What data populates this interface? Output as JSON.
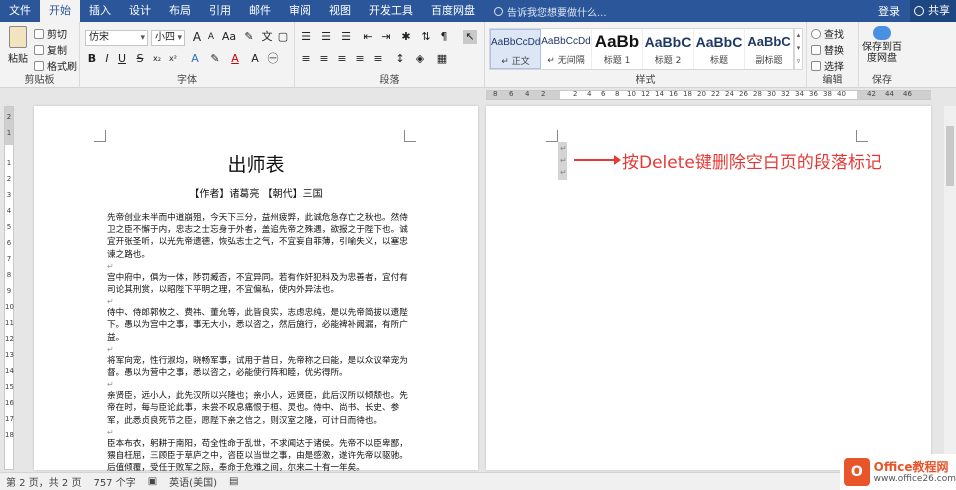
{
  "tabs": [
    "文件",
    "开始",
    "插入",
    "设计",
    "布局",
    "引用",
    "邮件",
    "审阅",
    "视图",
    "开发工具",
    "百度网盘"
  ],
  "active_tab": "开始",
  "tell_me": "告诉我您想要做什么...",
  "login": "登录",
  "share": "共享",
  "clipboard": {
    "paste": "粘贴",
    "cut": "剪切",
    "copy": "复制",
    "format_painter": "格式刷",
    "label": "剪贴板"
  },
  "font": {
    "name": "仿宋",
    "size": "小四",
    "grow": "A",
    "shrink": "A",
    "case": "Aa",
    "label": "字体"
  },
  "paragraph": {
    "label": "段落"
  },
  "styles": {
    "label": "样式",
    "items": [
      {
        "sample": "AaBbCcDd",
        "name": "↵ 正文"
      },
      {
        "sample": "AaBbCcDd",
        "name": "↵ 无间隔"
      },
      {
        "sample": "AaBb",
        "name": "标题 1"
      },
      {
        "sample": "AaBbC",
        "name": "标题 2"
      },
      {
        "sample": "AaBbC",
        "name": "标题"
      },
      {
        "sample": "AaBbC",
        "name": "副标题"
      }
    ]
  },
  "editing": {
    "find": "查找",
    "replace": "替换",
    "select": "选择",
    "label": "编辑"
  },
  "save": {
    "btn": "保存到百度网盘",
    "label": "保存"
  },
  "ruler": [
    "8",
    "6",
    "4",
    "2",
    "2",
    "4",
    "6",
    "8",
    "10",
    "12",
    "14",
    "16",
    "18",
    "20",
    "22",
    "24",
    "26",
    "28",
    "30",
    "32",
    "34",
    "36",
    "38",
    "40",
    "42",
    "44",
    "46"
  ],
  "vruler": [
    "2",
    "1",
    "1",
    "2",
    "3",
    "4",
    "5",
    "6",
    "7",
    "8",
    "9",
    "10",
    "11",
    "12",
    "13",
    "14",
    "15",
    "16",
    "17",
    "18"
  ],
  "doc": {
    "title": "出师表",
    "author": "【作者】诸葛亮 【朝代】三国",
    "paragraphs": [
      "先帝创业未半而中道崩殂，今天下三分，益州疲弊，此诚危急存亡之秋也。然侍卫之臣不懈于内，忠志之士忘身于外者，盖追先帝之殊遇，欲报之于陛下也。诚宜开张圣听，以光先帝遗德，恢弘志士之气，不宜妄自菲薄，引喻失义，以塞忠谏之路也。",
      "宫中府中，俱为一体，陟罚臧否，不宜异同。若有作奸犯科及为忠善者，宜付有司论其刑赏，以昭陛下平明之理，不宜偏私，使内外异法也。",
      "侍中、侍郎郭攸之、费祎、董允等，此皆良实，志虑忠纯，是以先帝简拔以遗陛下。愚以为宫中之事，事无大小，悉以咨之，然后施行，必能裨补阙漏，有所广益。",
      "将军向宠，性行淑均，晓畅军事，试用于昔日，先帝称之曰能，是以众议举宠为督。愚以为营中之事，悉以咨之，必能使行阵和睦，优劣得所。",
      "亲贤臣，远小人，此先汉所以兴隆也；亲小人，远贤臣，此后汉所以倾颓也。先帝在时，每与臣论此事，未尝不叹息痛恨于桓、灵也。侍中、尚书、长史、参军，此悉贞良死节之臣，愿陛下亲之信之，则汉室之隆，可计日而待也。",
      "臣本布衣，躬耕于南阳，苟全性命于乱世，不求闻达于诸侯。先帝不以臣卑鄙，猥自枉屈，三顾臣于草庐之中，咨臣以当世之事，由是感激，遂许先帝以驱驰。后值倾覆，受任于败军之际，奉命于危难之间，尔来二十有一年矣。"
    ]
  },
  "annotation": "按Delete键删除空白页的段落标记",
  "status": {
    "page": "第 2 页，共 2 页",
    "words": "757 个字",
    "lang": "英语(美国)",
    "zoom": "85%"
  },
  "logo": {
    "line1": "Office教程网",
    "line2": "www.office26.com",
    "mark": "O"
  }
}
